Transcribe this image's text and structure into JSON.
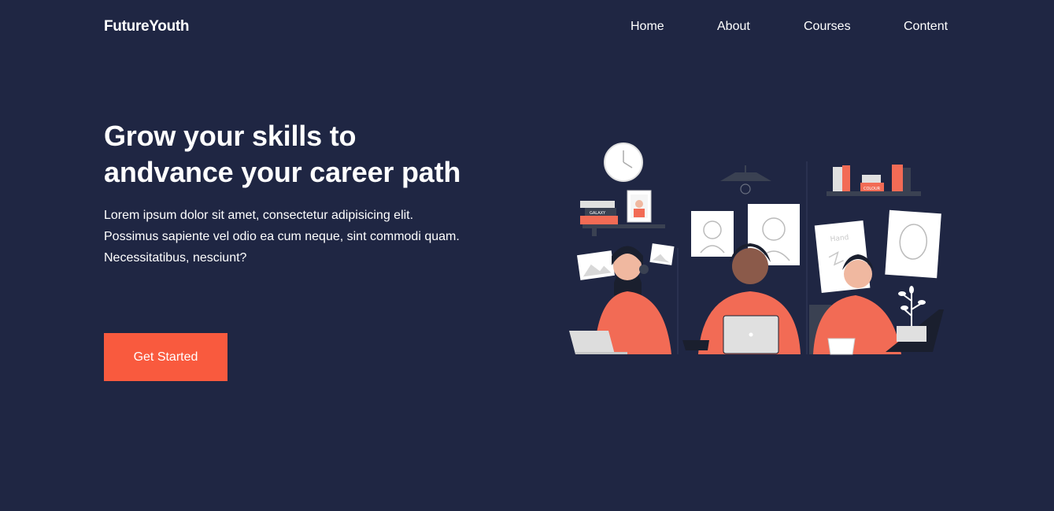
{
  "brand": {
    "name": "FutureYouth"
  },
  "nav": {
    "items": [
      {
        "label": "Home"
      },
      {
        "label": "About"
      },
      {
        "label": "Courses"
      },
      {
        "label": "Content"
      }
    ]
  },
  "hero": {
    "title": "Grow your skills to andvance your career path",
    "description": "Lorem ipsum dolor sit amet, consectetur adipisicing elit. Possimus sapiente vel odio ea cum neque, sint commodi quam. Necessitatibus, nesciunt?",
    "cta_label": "Get Started"
  },
  "illustration": {
    "book_label_1": "GALAXY",
    "book_label_2": "COLOUR",
    "note_text": "Hand"
  },
  "colors": {
    "background": "#1f2643",
    "accent": "#f95a3e",
    "text": "#ffffff"
  }
}
